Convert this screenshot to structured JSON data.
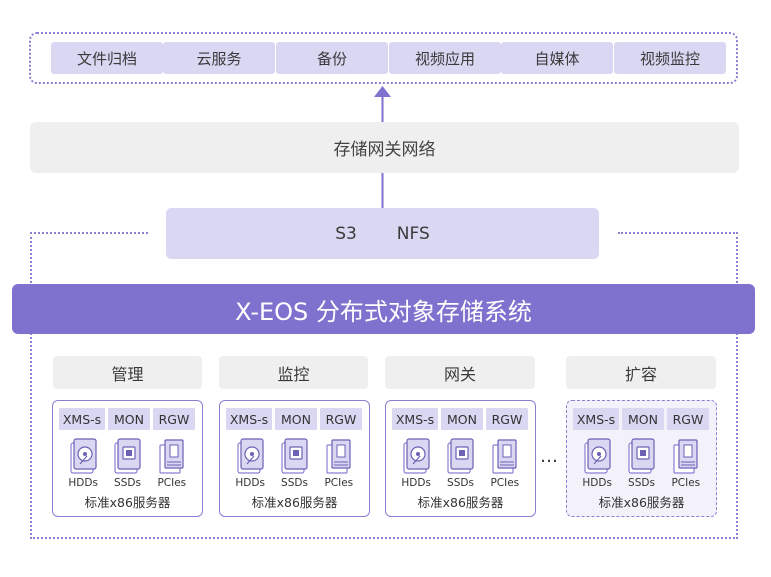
{
  "apps": [
    "文件归档",
    "云服务",
    "备份",
    "视频应用",
    "自媒体",
    "视频监控"
  ],
  "gateway": {
    "label": "存储网关网络"
  },
  "protocols": [
    "S3",
    "NFS"
  ],
  "banner": {
    "title": "X-EOS 分布式对象存储系统"
  },
  "roles": [
    "管理",
    "监控",
    "网关",
    "扩容"
  ],
  "servers": [
    {
      "services": [
        "XMS-s",
        "MON",
        "RGW"
      ],
      "devices": [
        "HDDs",
        "SSDs",
        "PCIes"
      ],
      "label": "标准x86服务器"
    },
    {
      "services": [
        "XMS-s",
        "MON",
        "RGW"
      ],
      "devices": [
        "HDDs",
        "SSDs",
        "PCIes"
      ],
      "label": "标准x86服务器"
    },
    {
      "services": [
        "XMS-s",
        "MON",
        "RGW"
      ],
      "devices": [
        "HDDs",
        "SSDs",
        "PCIes"
      ],
      "label": "标准x86服务器"
    },
    {
      "services": [
        "XMS-s",
        "MON",
        "RGW"
      ],
      "devices": [
        "HDDs",
        "SSDs",
        "PCIes"
      ],
      "label": "标准x86服务器"
    }
  ],
  "ellipsis": "…",
  "colors": {
    "accent": "#7f72cf",
    "light_purple": "#d9d7f2",
    "gray": "#efefef",
    "border": "#8b7fd3"
  }
}
